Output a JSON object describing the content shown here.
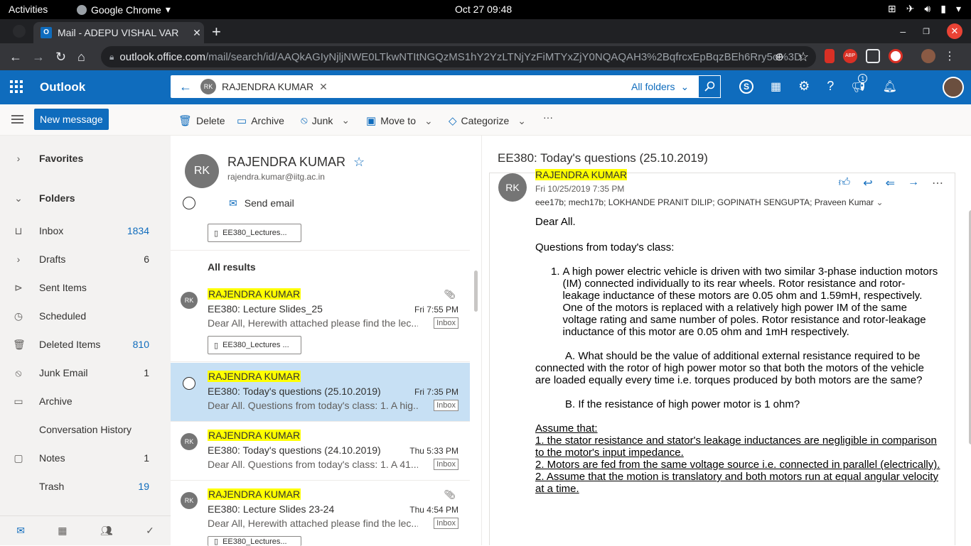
{
  "gnome": {
    "activities": "Activities",
    "app": "Google Chrome",
    "clock": "Oct 27  09:48"
  },
  "chrome": {
    "tab_title": "Mail - ADEPU VISHAL VAR",
    "url_host": "outlook.office.com",
    "url_path": "/mail/search/id/AAQkAGIyNjljNWE0LTkwNTItNGQzMS1hY2YzLTNjYzFiMTYxZjY0NQAQAH3%2BqfrcxEpBqzBEh6Rry5o%3D"
  },
  "outlook": {
    "brand": "Outlook",
    "search_chip": "RAJENDRA KUMAR",
    "search_chip_initials": "RK",
    "scope": "All folders",
    "notif_count": "1"
  },
  "commands": {
    "new_message": "New message",
    "delete": "Delete",
    "archive": "Archive",
    "junk": "Junk",
    "move_to": "Move to",
    "categorize": "Categorize",
    "more": "···"
  },
  "nav": {
    "favorites": "Favorites",
    "folders": "Folders",
    "items": [
      {
        "label": "Inbox",
        "count": "1834",
        "icon": "inbox-icon"
      },
      {
        "label": "Drafts",
        "count": "6",
        "icon": "chevron-right-icon"
      },
      {
        "label": "Sent Items",
        "count": "",
        "icon": "send-icon"
      },
      {
        "label": "Scheduled",
        "count": "",
        "icon": "clock-icon"
      },
      {
        "label": "Deleted Items",
        "count": "810",
        "icon": "trash-icon"
      },
      {
        "label": "Junk Email",
        "count": "1",
        "icon": "block-icon"
      },
      {
        "label": "Archive",
        "count": "",
        "icon": "archive-icon"
      },
      {
        "label": "Conversation History",
        "count": "",
        "icon": ""
      },
      {
        "label": "Notes",
        "count": "1",
        "icon": "note-icon"
      },
      {
        "label": "Trash",
        "count": "19",
        "icon": ""
      }
    ]
  },
  "contact": {
    "initials": "RK",
    "name": "RAJENDRA KUMAR",
    "email": "rajendra.kumar@iitg.ac.in",
    "send_email": "Send email",
    "attachment_top": "EE380_Lectures..."
  },
  "list": {
    "all_results": "All results",
    "messages": [
      {
        "initials": "RK",
        "sender": "RAJENDRA KUMAR",
        "subject": "EE380: Lecture Slides_25",
        "time": "Fri 7:55 PM",
        "preview": "Dear All, Herewith attached please find the lec...",
        "folder": "Inbox",
        "attachment": "EE380_Lectures ..."
      },
      {
        "initials": "",
        "sender": "RAJENDRA KUMAR",
        "subject": "EE380: Today's questions (25.10.2019)",
        "time": "Fri 7:35 PM",
        "preview": "Dear All. Questions from today's class: 1. A hig...",
        "folder": "Inbox",
        "attachment": ""
      },
      {
        "initials": "RK",
        "sender": "RAJENDRA KUMAR",
        "subject": "EE380: Today's questions (24.10.2019)",
        "time": "Thu 5:33 PM",
        "preview": "Dear All. Questions from today's class: 1. A 41...",
        "folder": "Inbox",
        "attachment": ""
      },
      {
        "initials": "RK",
        "sender": "RAJENDRA KUMAR",
        "subject": "EE380: Lecture Slides 23-24",
        "time": "Thu 4:54 PM",
        "preview": "Dear All, Herewith attached please find the lec...",
        "folder": "Inbox",
        "attachment": "EE380_Lectures..."
      }
    ]
  },
  "reading": {
    "subject": "EE380: Today's questions (25.10.2019)",
    "initials": "RK",
    "sender": "RAJENDRA KUMAR",
    "date": "Fri 10/25/2019 7:35 PM",
    "to": "eee17b; mech17b; LOKHANDE PRANIT DILIP; GOPINATH SENGUPTA; Praveen Kumar",
    "greeting": "Dear All.",
    "intro": "Questions from today's class:",
    "q1_num": "1.",
    "q1": "A high power electric vehicle is driven with two similar 3-phase induction motors (IM) connected individually to its rear wheels. Rotor resistance and rotor-leakage inductance of these motors are 0.05 ohm and 1.59mH, respectively. One of the motors is replaced with a relatively high power IM of the same voltage rating and same number of poles. Rotor resistance and rotor-leakage inductance of this motor are 0.05 ohm and 1mH respectively.",
    "qa": "A.  What should be the value of additional external resistance required to be connected with the rotor of high power motor so that both the motors of the vehicle are loaded equally every time i.e. torques produced by both motors are the same?",
    "qb": "B. If the resistance of high power motor is 1 ohm?",
    "assume": " Assume that: ",
    "a1": " 1. the stator resistance and stator's leakage inductances are negligible in comparison to the motor's input impedance.",
    "a2": "2. Motors are fed from the same voltage source i.e. connected in parallel (electrically).",
    "a3": "2. Assume that the motion is translatory and both motors run at equal angular velocity at a time."
  },
  "colors": {
    "brand": "#0f6cbd",
    "selected": "#c7e0f4",
    "highlight": "#ffff00"
  }
}
